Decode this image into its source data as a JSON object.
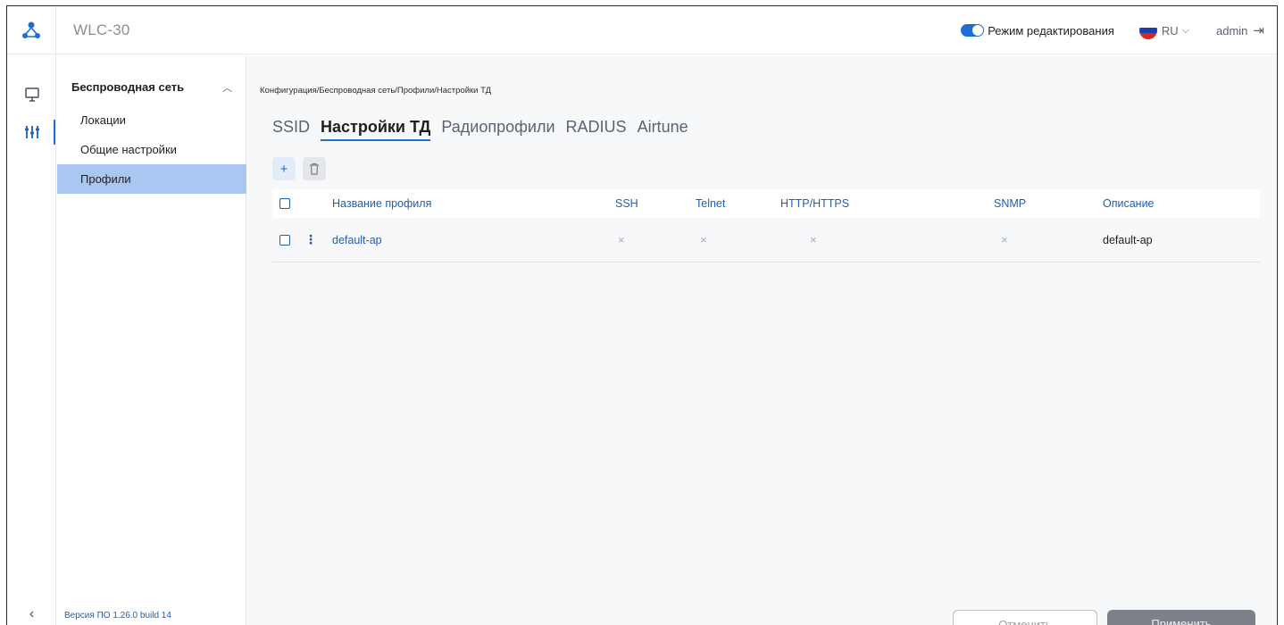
{
  "header": {
    "app_title": "WLC-30",
    "edit_mode_label": "Режим редактирования",
    "language": "RU",
    "user": "admin"
  },
  "rail": {
    "icons": [
      "monitor-icon",
      "settings-sliders-icon"
    ],
    "collapse": "‹"
  },
  "sidebar": {
    "group_label": "Беспроводная сеть",
    "items": [
      {
        "label": "Локации"
      },
      {
        "label": "Общие настройки"
      },
      {
        "label": "Профили"
      }
    ],
    "version": "Версия ПО 1.26.0 build 14"
  },
  "main": {
    "breadcrumb": "Конфигурация/Беспроводная сеть/Профили/Настройки ТД",
    "tabs": [
      {
        "label": "SSID"
      },
      {
        "label": "Настройки ТД"
      },
      {
        "label": "Радиопрофили"
      },
      {
        "label": "RADIUS"
      },
      {
        "label": "Airtune"
      }
    ],
    "active_tab": "Настройки ТД",
    "tools": {
      "add": "+",
      "delete": "🗑"
    },
    "table": {
      "columns": [
        "Название профиля",
        "SSH",
        "Telnet",
        "HTTP/HTTPS",
        "SNMP",
        "Описание"
      ],
      "rows": [
        {
          "name": "default-ap",
          "ssh": "×",
          "telnet": "×",
          "http": "×",
          "snmp": "×",
          "description": "default-ap"
        }
      ]
    }
  },
  "footer": {
    "cancel_label": "Отменить",
    "apply_label": "Применить"
  },
  "colors": {
    "accent": "#1f6ed4",
    "active_item_bg": "#a9c7f0",
    "apply_bg": "#7d8189"
  }
}
